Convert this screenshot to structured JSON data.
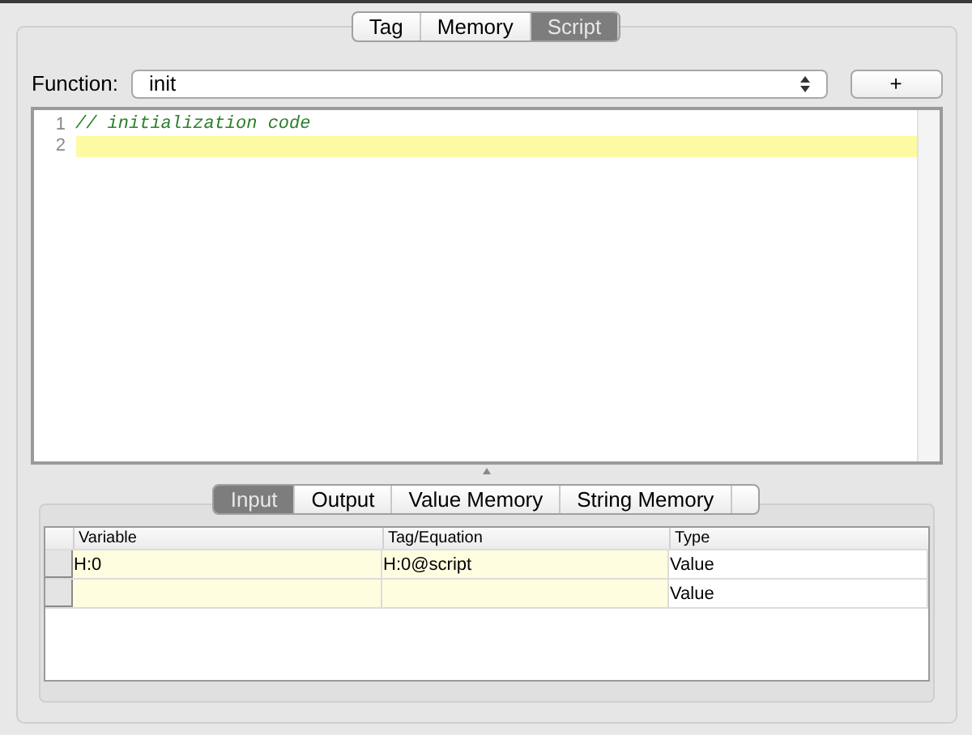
{
  "tabs": [
    {
      "label": "Tag",
      "selected": false
    },
    {
      "label": "Memory",
      "selected": false
    },
    {
      "label": "Script",
      "selected": true
    }
  ],
  "function": {
    "label": "Function:",
    "value": "init",
    "add_button": "+"
  },
  "editor": {
    "lines": [
      {
        "number": "1",
        "text": "// initialization code",
        "current": false
      },
      {
        "number": "2",
        "current": true
      }
    ]
  },
  "bottom_tabs": [
    {
      "label": "Input",
      "selected": true
    },
    {
      "label": "Output",
      "selected": false
    },
    {
      "label": "Value Memory",
      "selected": false
    },
    {
      "label": "String Memory",
      "selected": false
    }
  ],
  "table": {
    "columns": [
      {
        "label": "Variable",
        "editable": true
      },
      {
        "label": "Tag/Equation",
        "editable": true
      },
      {
        "label": "Type",
        "editable": false
      }
    ],
    "rows": [
      [
        "H:0",
        "H:0@script",
        "Value"
      ],
      [
        null,
        null,
        "Value"
      ]
    ]
  }
}
